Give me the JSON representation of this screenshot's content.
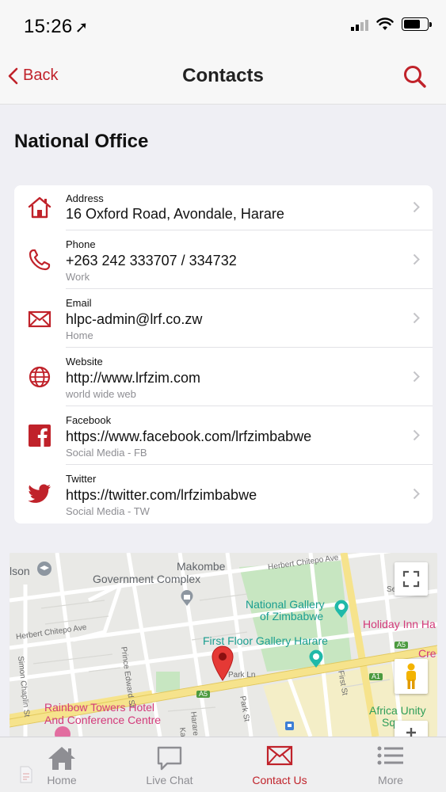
{
  "status": {
    "time": "15:26"
  },
  "nav": {
    "back_label": "Back",
    "title": "Contacts"
  },
  "section_title": "National Office",
  "contacts": [
    {
      "label": "Address",
      "value": "16 Oxford Road, Avondale, Harare",
      "sub": "",
      "icon": "home-icon"
    },
    {
      "label": "Phone",
      "value": "+263 242 333707 / 334732",
      "sub": "Work",
      "icon": "phone-icon"
    },
    {
      "label": "Email",
      "value": "hlpc-admin@lrf.co.zw",
      "sub": "Home",
      "icon": "email-icon"
    },
    {
      "label": "Website",
      "value": "http://www.lrfzim.com",
      "sub": "world wide web",
      "icon": "globe-icon"
    },
    {
      "label": "Facebook",
      "value": "https://www.facebook.com/lrfzimbabwe",
      "sub": "Social Media - FB",
      "icon": "facebook-icon"
    },
    {
      "label": "Twitter",
      "value": "https://twitter.com/lrfzimbabwe",
      "sub": "Social Media - TW",
      "icon": "twitter-icon"
    }
  ],
  "map": {
    "labels": {
      "ison": "lson",
      "makombe": "Makombe",
      "gov_complex": "Government Complex",
      "national_gallery_1": "National Gallery",
      "national_gallery_2": "of Zimbabwe",
      "first_floor": "First Floor Gallery Harare",
      "holiday_inn": "Holiday Inn Ha",
      "cre": "Cre",
      "rainbow_1": "Rainbow Towers Hotel",
      "rainbow_2": "And Conference Centre",
      "africa_unity_1": "Africa Unity",
      "africa_unity_2": "Sq",
      "herbert_chitepo_1": "Herbert Chitepo Ave",
      "herbert_chitepo_2": "Herbert Chitepo Ave",
      "herbert_chitepo_3": "Herbert Chitepo Ave",
      "prince_edward": "Prince Edward St",
      "selous": "Selous A",
      "first_st": "First St",
      "park_st": "Park St",
      "harare_st": "Harare St",
      "kaguvi": "Kaguvi",
      "simon_chaplin": "Simon Chaplin St",
      "park_ln": "Park Ln",
      "a5_1": "A5",
      "a5_2": "A5",
      "a1": "A1"
    }
  },
  "tabs": [
    {
      "label": "Home",
      "icon": "home-tab-icon"
    },
    {
      "label": "Live Chat",
      "icon": "chat-icon"
    },
    {
      "label": "Contact Us",
      "icon": "envelope-icon"
    },
    {
      "label": "More",
      "icon": "list-icon"
    }
  ],
  "colors": {
    "accent": "#c0222a",
    "park": "#c7e6c1",
    "road_major": "#f6e38c"
  }
}
